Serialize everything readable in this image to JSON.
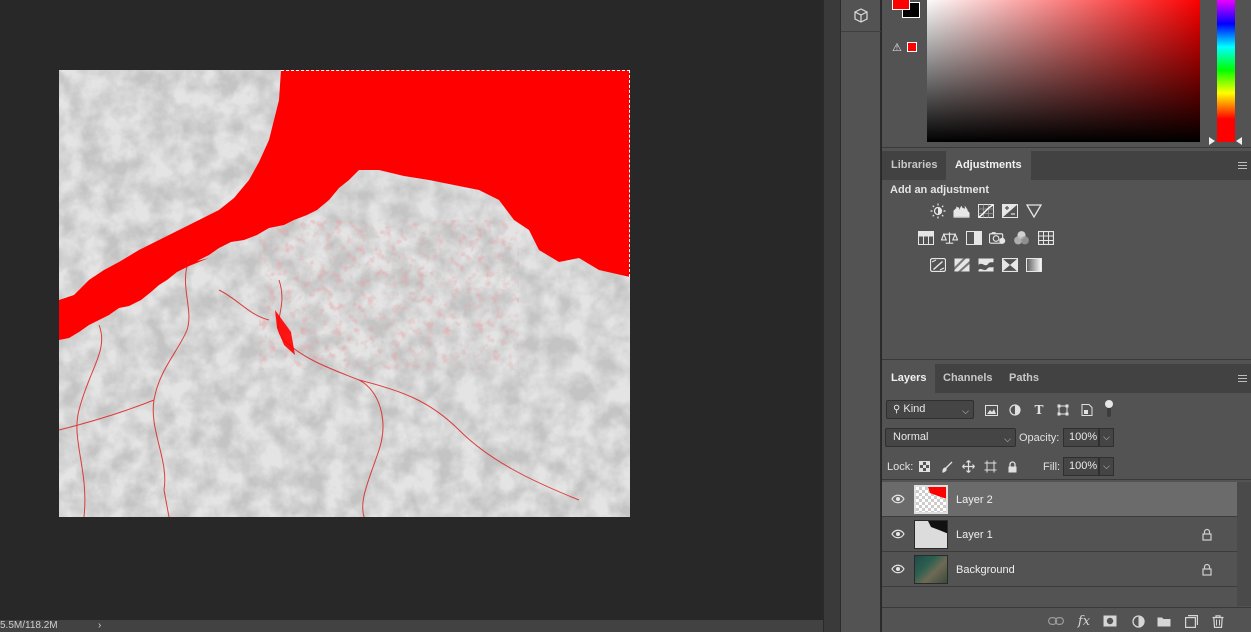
{
  "status_bar": {
    "doc_size": "5.5M/118.2M",
    "arrow": "›"
  },
  "color_panel": {
    "foreground_color": "#ff0000",
    "background_color": "#000000",
    "gamut_warning_icon": "warning-triangle-icon"
  },
  "adjustments_panel": {
    "tabs": [
      "Libraries",
      "Adjustments"
    ],
    "active_tab": "Adjustments",
    "title": "Add an adjustment",
    "icon_rows": [
      [
        "brightness-contrast-icon",
        "levels-icon",
        "curves-icon",
        "exposure-icon",
        "vibrance-icon"
      ],
      [
        "hue-saturation-icon",
        "color-balance-icon",
        "black-white-icon",
        "photo-filter-icon",
        "channel-mixer-icon",
        "color-lookup-icon"
      ],
      [
        "invert-icon",
        "posterize-icon",
        "threshold-icon",
        "selective-color-icon",
        "gradient-map-icon"
      ]
    ]
  },
  "layers_panel": {
    "tabs": [
      "Layers",
      "Channels",
      "Paths"
    ],
    "active_tab": "Layers",
    "filter_kind": "Kind",
    "blend_mode": "Normal",
    "opacity_label": "Opacity:",
    "opacity_value": "100%",
    "lock_label": "Lock:",
    "fill_label": "Fill:",
    "fill_value": "100%",
    "layers": [
      {
        "name": "Layer 2",
        "visible": true,
        "locked": false,
        "selected": true
      },
      {
        "name": "Layer 1",
        "visible": true,
        "locked": true,
        "selected": false
      },
      {
        "name": "Background",
        "visible": true,
        "locked": true,
        "selected": false
      }
    ],
    "footer_icons": [
      "link-layers-icon",
      "fx-icon",
      "add-mask-icon",
      "new-adjustment-icon",
      "new-group-icon",
      "new-layer-icon",
      "delete-layer-icon"
    ],
    "fx_label": "fx"
  }
}
